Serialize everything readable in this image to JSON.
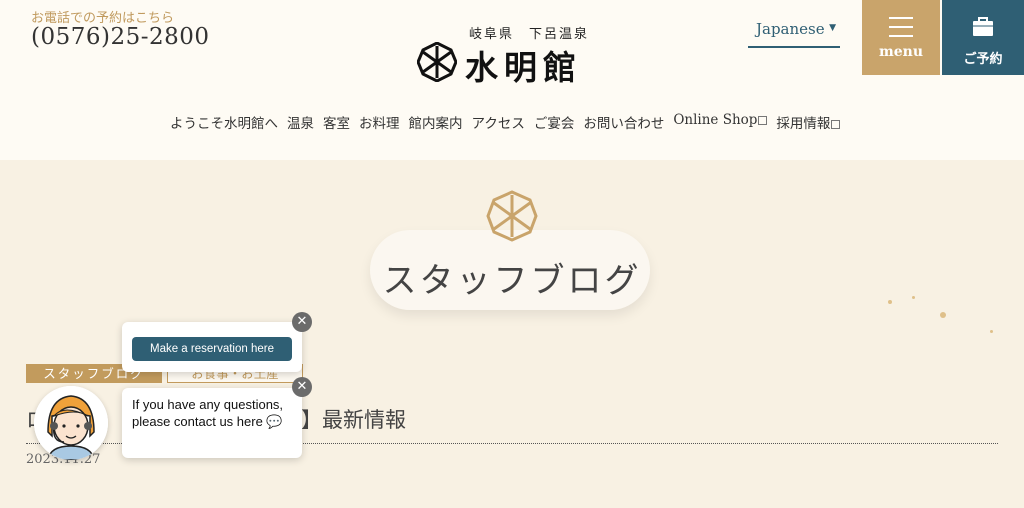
{
  "header": {
    "phone_label": "お電話での予約はこちら",
    "phone_number": "(0576)25-2800",
    "logo_sub": "岐阜県　下呂温泉",
    "logo_main": "水明館",
    "language": "Japanese",
    "menu_label": "menu",
    "reserve_label": "ご予約"
  },
  "nav": {
    "items": [
      "ようこそ水明館へ",
      "温泉",
      "客室",
      "お料理",
      "館内案内",
      "アクセス",
      "ご宴会",
      "お問い合わせ",
      "Online Shop",
      "採用情報"
    ]
  },
  "hero": {
    "title": "スタッフブログ"
  },
  "post": {
    "tag_primary": "スタッフブログ",
    "tag_secondary": "お食事・お土産",
    "title_start": "ロ　ラ",
    "title_end": "】最新情報",
    "date": "2023.11.27"
  },
  "chat": {
    "reservation_button": "Make a reservation here",
    "help_text": "If you have any questions, please contact us here 💬",
    "close_symbol": "✕"
  },
  "colors": {
    "gold": "#c29b5d",
    "navy": "#2f5f74",
    "background": "#fdf9f1"
  }
}
